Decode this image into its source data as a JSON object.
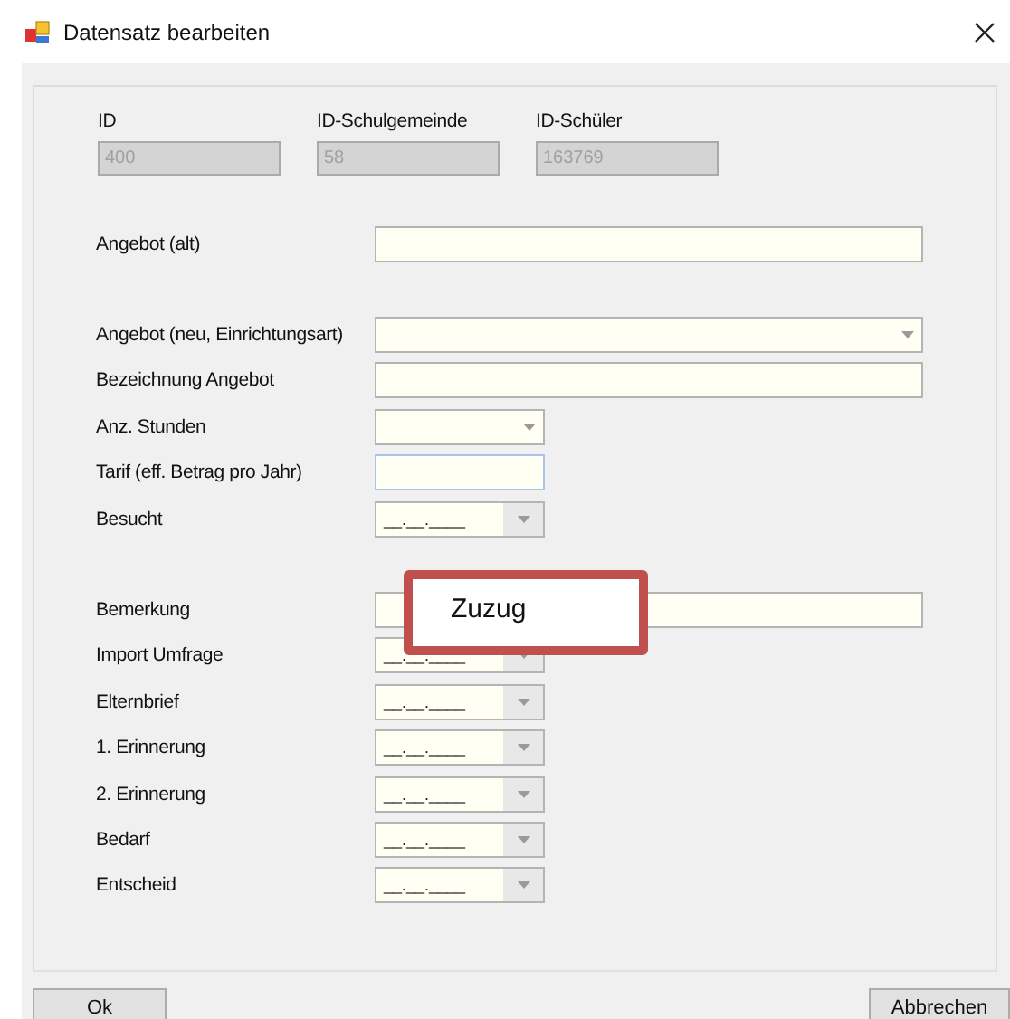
{
  "window": {
    "title": "Datensatz bearbeiten"
  },
  "ids": [
    {
      "label": "ID",
      "value": "400"
    },
    {
      "label": "ID-Schulgemeinde",
      "value": "58"
    },
    {
      "label": "ID-Schüler",
      "value": "163769"
    }
  ],
  "sections": [
    {
      "rows": [
        {
          "label": "Angebot (alt)",
          "kind": "text",
          "wide": true,
          "value": "",
          "focused": false
        }
      ]
    },
    {
      "rows": [
        {
          "label": "Angebot (neu, Einrichtungsart)",
          "kind": "combo",
          "wide": true,
          "value": "",
          "focused": false
        },
        {
          "label": "Bezeichnung Angebot",
          "kind": "text",
          "wide": true,
          "value": "",
          "focused": false
        },
        {
          "label": "Anz. Stunden",
          "kind": "combo",
          "wide": false,
          "value": "",
          "focused": false
        },
        {
          "label": "Tarif (eff. Betrag pro Jahr)",
          "kind": "text",
          "wide": false,
          "value": "",
          "focused": true
        },
        {
          "label": "Besucht",
          "kind": "date",
          "wide": false,
          "value": "__.__.____",
          "focused": false
        }
      ]
    },
    {
      "rows": [
        {
          "label": "Bemerkung",
          "kind": "text",
          "wide": true,
          "value": "",
          "focused": false
        },
        {
          "label": "Import Umfrage",
          "kind": "date",
          "wide": false,
          "value": "__.__.____",
          "focused": false
        },
        {
          "label": "Elternbrief",
          "kind": "date",
          "wide": false,
          "value": "__.__.____",
          "focused": false
        },
        {
          "label": "1. Erinnerung",
          "kind": "date",
          "wide": false,
          "value": "__.__.____",
          "focused": false
        },
        {
          "label": "2. Erinnerung",
          "kind": "date",
          "wide": false,
          "value": "__.__.____",
          "focused": false
        },
        {
          "label": "Bedarf",
          "kind": "date",
          "wide": false,
          "value": "__.__.____",
          "focused": false
        },
        {
          "label": "Entscheid",
          "kind": "date",
          "wide": false,
          "value": "__.__.____",
          "focused": false
        }
      ]
    }
  ],
  "callout": {
    "text": "Zuzug"
  },
  "buttons": [
    {
      "label": "Ok"
    },
    {
      "label": "Abbrechen"
    }
  ]
}
